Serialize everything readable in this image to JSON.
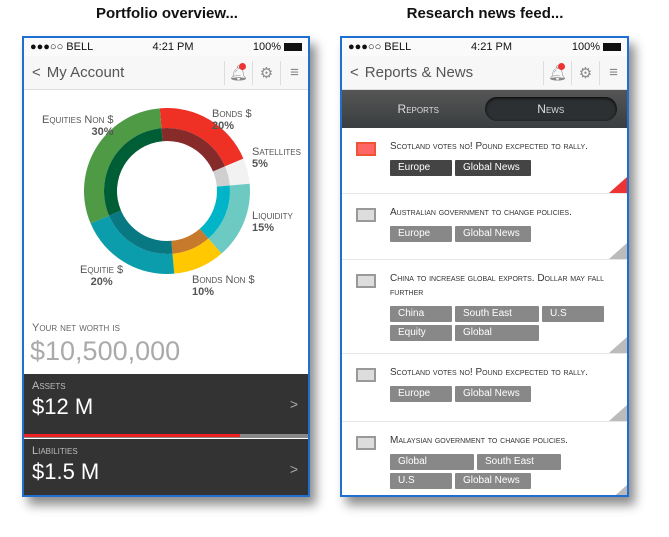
{
  "captions": [
    "Portfolio overview...",
    "Research news feed..."
  ],
  "status": {
    "carrier": "●●●○○ BELL",
    "time": "4:21 PM",
    "battery": "100%"
  },
  "left": {
    "title": "My Account",
    "chart_data": {
      "type": "pie",
      "donut": true,
      "categories": [
        "Bonds $",
        "Satellites",
        "Liquidity",
        "Bonds Non $",
        "Equitie $",
        "Equities Non $"
      ],
      "values": [
        20,
        5,
        15,
        10,
        20,
        30
      ],
      "labels": [
        "20%",
        "5%",
        "15%",
        "10%",
        "20%",
        "30%"
      ],
      "colors": [
        "#ee3124",
        "#f2f2f2",
        "#6ccac3",
        "#ffc800",
        "#0b9dab",
        "#4e9a45"
      ],
      "inner_colors": [
        "#862a2a",
        "#cfcfcf",
        "#00b5c8",
        "#c87a2c",
        "#087982",
        "#005e36"
      ]
    },
    "net_worth_label": "Your net worth is",
    "net_worth": "$10,500,000",
    "assets_label": "Assets",
    "assets": "$12 M",
    "assets_bar_pct": 76,
    "liabilities_label": "Liabilities",
    "liabilities": "$1.5 M"
  },
  "right": {
    "title": "Reports & News",
    "tabs": [
      "Reports",
      "News"
    ],
    "items": [
      {
        "headline": "Scotland votes no! Pound excpected to rally.",
        "tags": [
          "Europe",
          "Global News"
        ],
        "active": true
      },
      {
        "headline": "Australian government to change policies.",
        "tags": [
          "Europe",
          "Global News"
        ]
      },
      {
        "headline": "China to increase global exports. Dollar may fall further",
        "tags": [
          "China",
          "South East Asia",
          "U.S",
          "Equity",
          "Global economy"
        ]
      },
      {
        "headline": "Scotland votes no! Pound excpected to rally.",
        "tags": [
          "Europe",
          "Global News"
        ]
      },
      {
        "headline": "Malaysian government to change policies.",
        "tags": [
          "Global Economy",
          "South East Asia",
          "U.S",
          "Global News"
        ]
      }
    ]
  }
}
